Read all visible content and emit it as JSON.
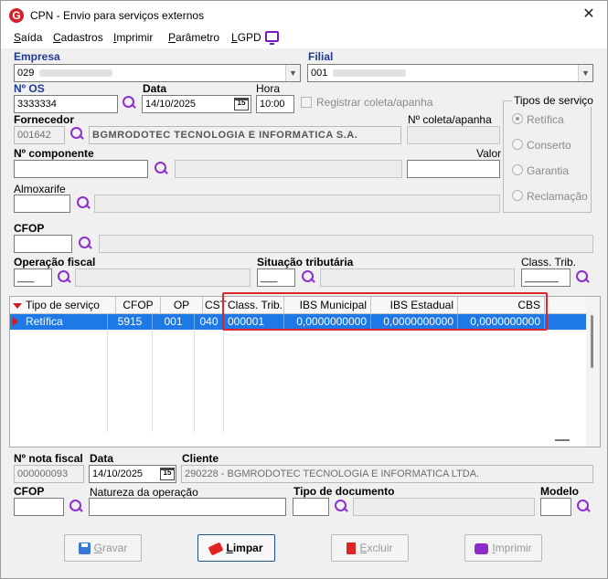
{
  "window": {
    "title": "CPN - Envio para serviços externos",
    "logo_letter": "G",
    "close": "✕"
  },
  "menu": [
    {
      "key": "S",
      "rest": "aída"
    },
    {
      "key": "C",
      "rest": "adastros"
    },
    {
      "key": "I",
      "rest": "mprimir"
    },
    {
      "key": "P",
      "rest": "arâmetro"
    },
    {
      "key": "L",
      "rest": "GPD"
    }
  ],
  "form": {
    "empresa": {
      "label": "Empresa",
      "value": "029"
    },
    "filial": {
      "label": "Filial",
      "value": "001"
    },
    "os": {
      "label": "Nº  OS",
      "value": "3333334"
    },
    "data": {
      "label": "Data",
      "value": "14/10/2025"
    },
    "hora": {
      "label": "Hora",
      "value": "10:00"
    },
    "registrar": {
      "label": "Registrar coleta/apanha"
    },
    "fornecedor": {
      "label": "Fornecedor",
      "code": "001642",
      "name": "BGMRODOTEC TECNOLOGIA E INFORMATICA S.A."
    },
    "coleta": {
      "label": "Nº coleta/apanha",
      "value": ""
    },
    "componente": {
      "label": "Nº  componente",
      "value": ""
    },
    "valor": {
      "label": "Valor",
      "value": ""
    },
    "almoxarife": {
      "label": "Almoxarife",
      "value": ""
    },
    "cfop": {
      "label": "CFOP",
      "value": ""
    },
    "operacao": {
      "label": "Operação fiscal",
      "value": "___"
    },
    "situacao": {
      "label": "Situação tributária",
      "value": "___"
    },
    "class_trib": {
      "label": "Class. Trib.",
      "value": "______"
    },
    "calendar_icon_text": "15"
  },
  "tipos_servico": {
    "title": "Tipos de serviço",
    "options": [
      "Retífica",
      "Conserto",
      "Garantia",
      "Reclamação"
    ],
    "selected": 0
  },
  "grid": {
    "headers": [
      "Tipo de serviço",
      "CFOP",
      "OP",
      "CST",
      "Class. Trib.",
      "IBS Municipal",
      "IBS Estadual",
      "CBS"
    ],
    "rows": [
      [
        "Retífica",
        "5915",
        "001",
        "040",
        "000001",
        "0,0000000000",
        "0,0000000000",
        "0,0000000000"
      ]
    ]
  },
  "nota": {
    "numero": {
      "label": "Nº nota fiscal",
      "value": "000000093"
    },
    "data": {
      "label": "Data",
      "value": "14/10/2025"
    },
    "cliente": {
      "label": "Cliente",
      "value": "290228 - BGMRODOTEC TECNOLOGIA E INFORMATICA LTDA."
    },
    "cfop": {
      "label": "CFOP",
      "value": ""
    },
    "natureza": {
      "label": "Natureza da operação",
      "value": ""
    },
    "tipo_doc": {
      "label": "Tipo de documento",
      "value": ""
    },
    "modelo": {
      "label": "Modelo",
      "value": ""
    }
  },
  "buttons": {
    "gravar": {
      "key": "G",
      "rest": "ravar"
    },
    "limpar": {
      "key": "L",
      "rest": "impar"
    },
    "excluir": {
      "key": "E",
      "rest": "xcluir"
    },
    "imprimir": {
      "key": "I",
      "rest": "mprimir"
    }
  },
  "colors": {
    "selection": "#1e78e6",
    "highlight": "#e0262b",
    "label_blue": "#1f3a93",
    "search_icon": "#8c2fcf"
  }
}
